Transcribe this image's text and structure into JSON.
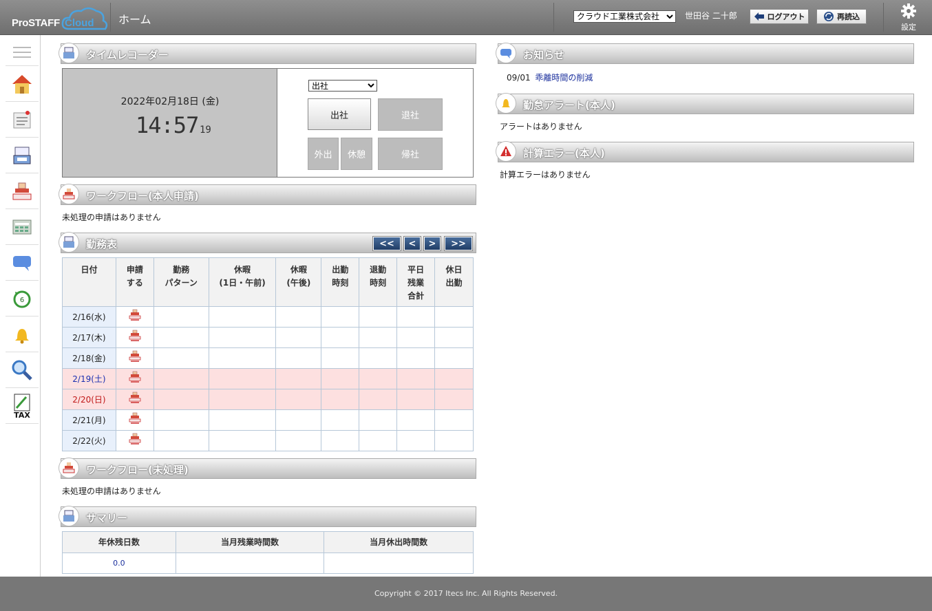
{
  "app": {
    "logo_pro": "ProSTAFF",
    "logo_cloud": "Cloud",
    "page_title": "ホーム"
  },
  "header": {
    "company_selected": "クラウド工業株式会社",
    "username": "世田谷 二十郎",
    "logout_label": "ログアウト",
    "reload_label": "再読込",
    "settings_label": "設定"
  },
  "sidebar": {
    "items": [
      "menu-icon",
      "home-icon",
      "notice-board-icon",
      "time-recorder-icon",
      "workflow-stamp-icon",
      "calculator-icon",
      "chat-bubble-icon",
      "history-6-icon",
      "bell-icon",
      "magnifier-icon",
      "tax-icon"
    ]
  },
  "timerecorder": {
    "title": "タイムレコーダー",
    "date": "2022年02月18日 (金)",
    "time": "14:57",
    "seconds": "19",
    "select_value": "出社",
    "buttons": {
      "checkin": "出社",
      "checkout": "退社",
      "out": "外出",
      "rest": "休憩",
      "return": "帰社"
    }
  },
  "workflow_self": {
    "title": "ワークフロー(本人申請)",
    "empty": "未処理の申請はありません"
  },
  "worktable": {
    "title": "勤務表",
    "nav": [
      "<<",
      "<",
      ">",
      ">>"
    ],
    "columns": [
      [
        "日付"
      ],
      [
        "申請",
        "する"
      ],
      [
        "勤務",
        "パターン"
      ],
      [
        "休暇",
        "(1日・午前)"
      ],
      [
        "休暇",
        "(午後)"
      ],
      [
        "出勤",
        "時刻"
      ],
      [
        "退勤",
        "時刻"
      ],
      [
        "平日",
        "残業",
        "合計"
      ],
      [
        "休日",
        "出勤"
      ]
    ],
    "rows": [
      {
        "date": "2/16(水)",
        "type": "weekday"
      },
      {
        "date": "2/17(木)",
        "type": "weekday"
      },
      {
        "date": "2/18(金)",
        "type": "weekday"
      },
      {
        "date": "2/19(土)",
        "type": "saturday"
      },
      {
        "date": "2/20(日)",
        "type": "sunday"
      },
      {
        "date": "2/21(月)",
        "type": "weekday"
      },
      {
        "date": "2/22(火)",
        "type": "weekday"
      }
    ]
  },
  "workflow_pending": {
    "title": "ワークフロー(未処理)",
    "empty": "未処理の申請はありません"
  },
  "summary": {
    "title": "サマリー",
    "columns": [
      "年休残日数",
      "当月残業時間数",
      "当月休出時間数"
    ],
    "values": [
      "0.0",
      "",
      ""
    ]
  },
  "notices": {
    "title": "お知らせ",
    "items": [
      {
        "date": "09/01",
        "text": "乖離時間の削減"
      }
    ]
  },
  "alerts": {
    "title": "勤怠アラート(本人)",
    "empty": "アラートはありません"
  },
  "calc_errors": {
    "title": "計算エラー(本人)",
    "empty": "計算エラーはありません"
  },
  "footer": {
    "copyright": "Copyright © 2017 Itecs Inc. All Rights Reserved."
  },
  "colors": {
    "header_bg": "#7a7a7a",
    "weekend_row": "#fde0e0",
    "date_cell": "#e8f0fb",
    "saturday_text": "#1a2fb0",
    "sunday_text": "#c01818",
    "link": "#1a2f9c"
  }
}
